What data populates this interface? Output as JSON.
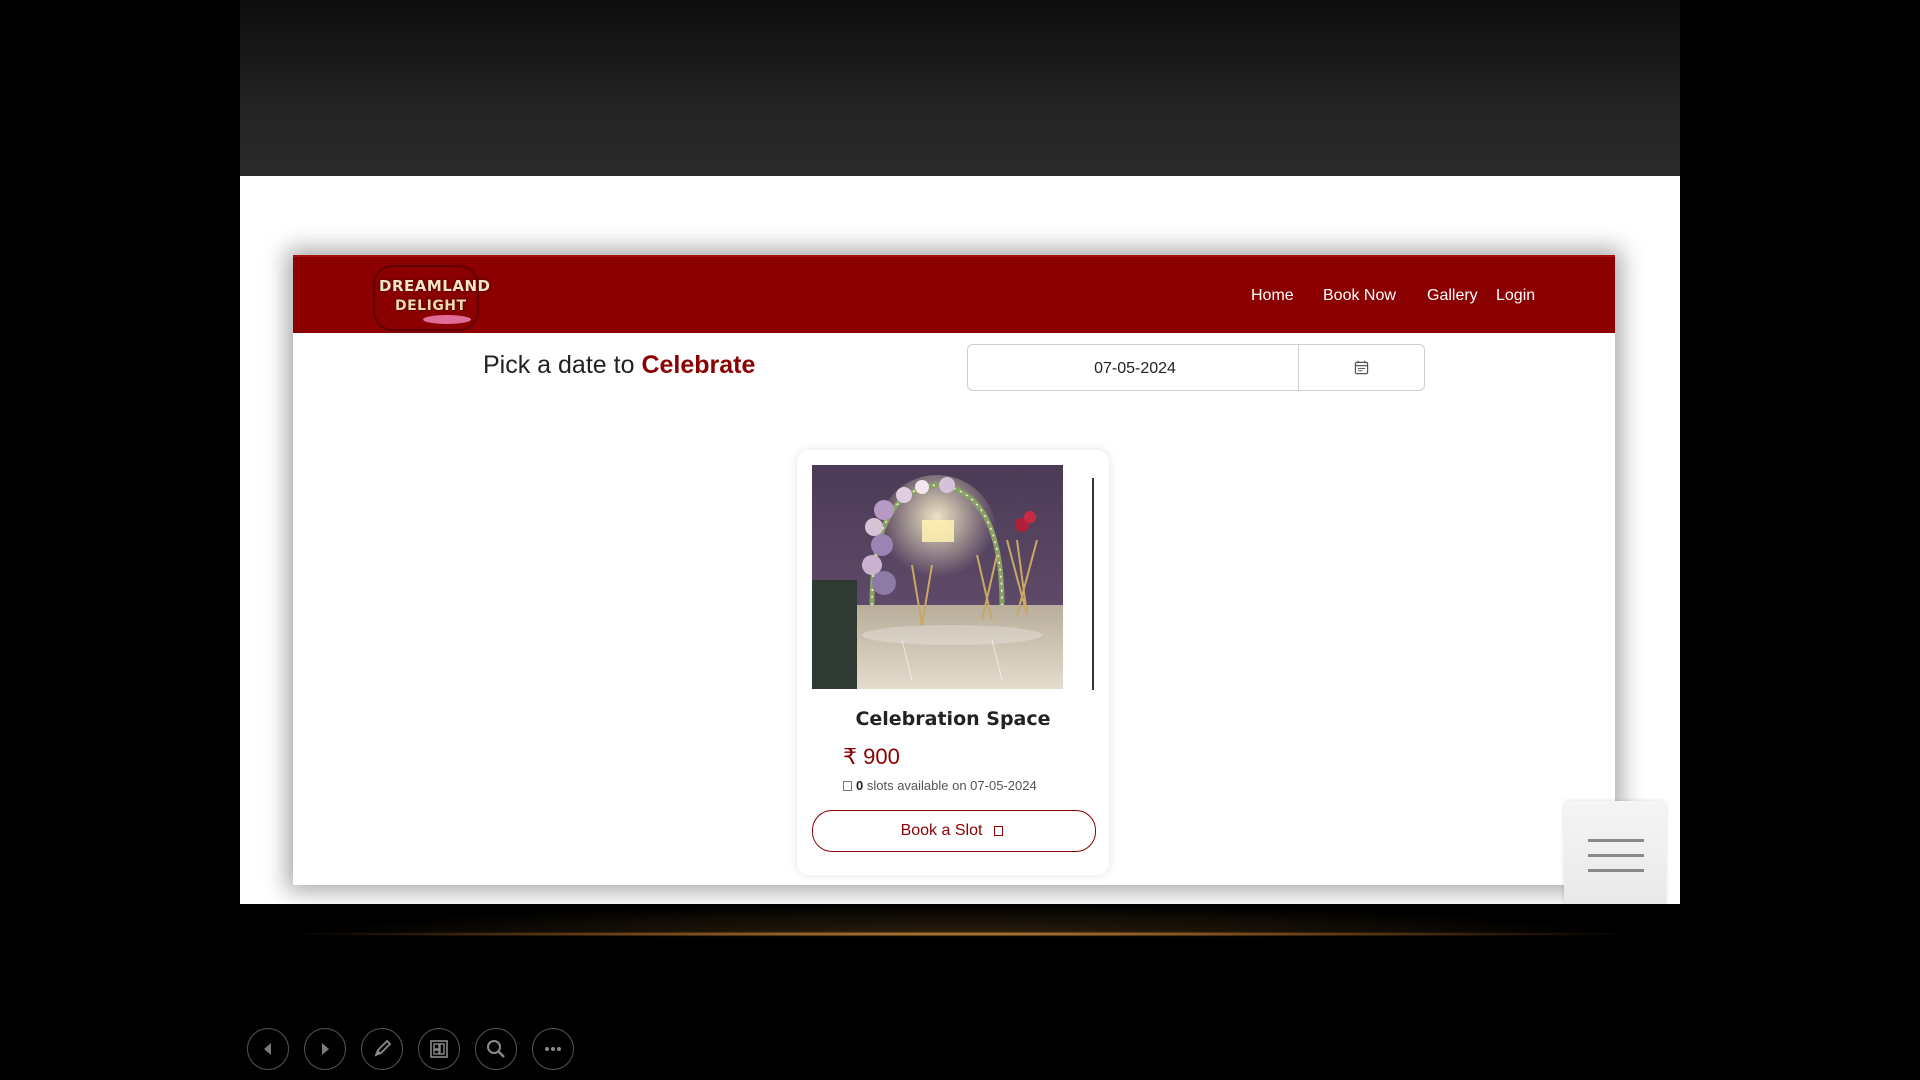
{
  "site": {
    "logo": {
      "line1": "DREAMLAND",
      "line2": "DELIGHT"
    },
    "nav": {
      "home": "Home",
      "book_now": "Book Now",
      "gallery": "Gallery",
      "login": "Login"
    },
    "heading": {
      "prefix": "Pick a date to ",
      "accent": "Celebrate"
    },
    "date_picker": {
      "value": "07-05-2024",
      "icon": "calendar-icon"
    },
    "card": {
      "title": "Celebration Space",
      "price": "₹ 900",
      "slots_count": "0",
      "slots_text": " slots available on 07-05-2024",
      "button_label": "Book a Slot"
    }
  },
  "presenter_toolbar": {
    "buttons": [
      "previous-icon",
      "next-icon",
      "pen-icon",
      "slides-icon",
      "zoom-icon",
      "more-icon"
    ]
  },
  "colors": {
    "brand": "#8b0000",
    "navbar_bg": "#8b0000",
    "accent_gold": "#c8902e"
  }
}
